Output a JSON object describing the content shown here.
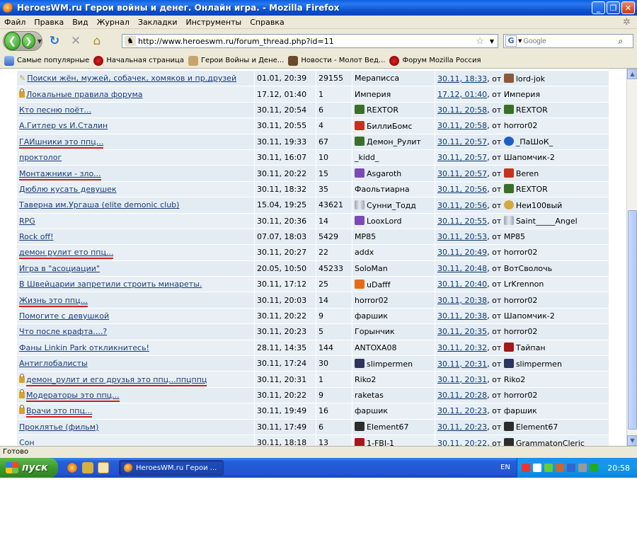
{
  "window": {
    "title": "HeroesWM.ru Герои войны и денег. Онлайн игра. - Mozilla Firefox"
  },
  "menu": [
    "Файл",
    "Правка",
    "Вид",
    "Журнал",
    "Закладки",
    "Инструменты",
    "Справка"
  ],
  "address": {
    "url": "http://www.heroeswm.ru/forum_thread.php?id=11"
  },
  "search": {
    "placeholder": "Google"
  },
  "bookmarks": [
    "Самые популярные",
    "Начальная страница",
    "Герои Войны и Дене...",
    "Новости - Молот Вед...",
    "Форум Mozilla Россия"
  ],
  "threads": [
    {
      "title": "Поиски жён, мужей, собачек, хомяков и пр.друзей",
      "date": "01.01, 20:39",
      "count": "29155",
      "author": "Мерaписса",
      "last": "30.11, 18:33",
      "from": "lord-jok"
    },
    {
      "title": "Локальные правила форума",
      "date": "17.12, 01:40",
      "count": "1",
      "author": "Империя",
      "last": "17.12, 01:40",
      "from": "Империя"
    },
    {
      "title": "Кто песню поёт...",
      "date": "30.11, 20:54",
      "count": "6",
      "author": "REXTOR",
      "last": "30.11, 20:58",
      "from": "REXTOR"
    },
    {
      "title": "А.Гитлер vs И.Сталин",
      "date": "30.11, 20:55",
      "count": "4",
      "author": "БиллиБомс",
      "last": "30.11, 20:58",
      "from": "horror02"
    },
    {
      "title": "ГАИшники это ппц...",
      "date": "30.11, 19:33",
      "count": "67",
      "author": "Демон_Рулит",
      "last": "30.11, 20:57",
      "from": "_ПаШоК_"
    },
    {
      "title": "проктолог",
      "date": "30.11, 16:07",
      "count": "10",
      "author": "_kidd_",
      "last": "30.11, 20:57",
      "from": "Шапомчик-2"
    },
    {
      "title": "Монтажники - зло...",
      "date": "30.11, 20:22",
      "count": "15",
      "author": "Asgaroth",
      "last": "30.11, 20:57",
      "from": "Beren"
    },
    {
      "title": "Дюблю кусать девушек",
      "date": "30.11, 18:32",
      "count": "35",
      "author": "Фаольтиарна",
      "last": "30.11, 20:56",
      "from": "REXTOR"
    },
    {
      "title": "Таверна им.Ургаша (elite demonic club)",
      "date": "15.04, 19:25",
      "count": "43621",
      "author": "Сунни_Тодд",
      "last": "30.11, 20:56",
      "from": "Неи100вый"
    },
    {
      "title": "RPG",
      "date": "30.11, 20:36",
      "count": "14",
      "author": "LooxLord",
      "last": "30.11, 20:55",
      "from": "Saint_____Angel"
    },
    {
      "title": "Rock off!",
      "date": "07.07, 18:03",
      "count": "5429",
      "author": "MP85",
      "last": "30.11, 20:53",
      "from": "MP85"
    },
    {
      "title": "демон рулит ето ппц...",
      "date": "30.11, 20:27",
      "count": "22",
      "author": "addx",
      "last": "30.11, 20:49",
      "from": "horror02"
    },
    {
      "title": "Игра в \"асоциации\"",
      "date": "20.05, 10:50",
      "count": "45233",
      "author": "SoloMan",
      "last": "30.11, 20:48",
      "from": "ВотСволочь"
    },
    {
      "title": "В Швейцарии запретили строить минареты.",
      "date": "30.11, 17:12",
      "count": "25",
      "author": "uDafff",
      "last": "30.11, 20:40",
      "from": "LrKrennon"
    },
    {
      "title": "Жизнь это ппц...",
      "date": "30.11, 20:03",
      "count": "14",
      "author": "horror02",
      "last": "30.11, 20:38",
      "from": "horror02"
    },
    {
      "title": "Помогите с девушкой",
      "date": "30.11, 20:22",
      "count": "9",
      "author": "фаршик",
      "last": "30.11, 20:38",
      "from": "Шапомчик-2"
    },
    {
      "title": "Что после крафта....?",
      "date": "30.11, 20:23",
      "count": "5",
      "author": "Горынчик",
      "last": "30.11, 20:35",
      "from": "horror02"
    },
    {
      "title": "Фаны Linkin Park откликнитесь!",
      "date": "28.11, 14:35",
      "count": "144",
      "author": "ANTOXA08",
      "last": "30.11, 20:32",
      "from": "Тайпан"
    },
    {
      "title": "Антиглобалисты",
      "date": "30.11, 17:24",
      "count": "30",
      "author": "slimpermen",
      "last": "30.11, 20:31",
      "from": "slimpermen"
    },
    {
      "title": "демон_рулит и его друзья это ппц...ппцппц",
      "date": "30.11, 20:31",
      "count": "1",
      "author": "Riko2",
      "last": "30.11, 20:31",
      "from": "Riko2"
    },
    {
      "title": "Модераторы это ппц...",
      "date": "30.11, 20:22",
      "count": "9",
      "author": "raketas",
      "last": "30.11, 20:28",
      "from": "horror02"
    },
    {
      "title": "Врачи это ппц...",
      "date": "30.11, 19:49",
      "count": "16",
      "author": "фаршик",
      "last": "30.11, 20:23",
      "from": "фаршик"
    },
    {
      "title": "Проклятье (фильм)",
      "date": "30.11, 17:49",
      "count": "6",
      "author": "Element67",
      "last": "30.11, 20:23",
      "from": "Element67"
    },
    {
      "title": "Сон",
      "date": "30.11, 18:18",
      "count": "13",
      "author": "1-FBI-1",
      "last": "30.11, 20:22",
      "from": "GrammatonCleric"
    }
  ],
  "from_label": ", от",
  "status": {
    "text": "Готово"
  },
  "taskbar": {
    "start": "пуск",
    "item": "HeroesWM.ru Герои ...",
    "lang": "EN",
    "clock": "20:58"
  }
}
